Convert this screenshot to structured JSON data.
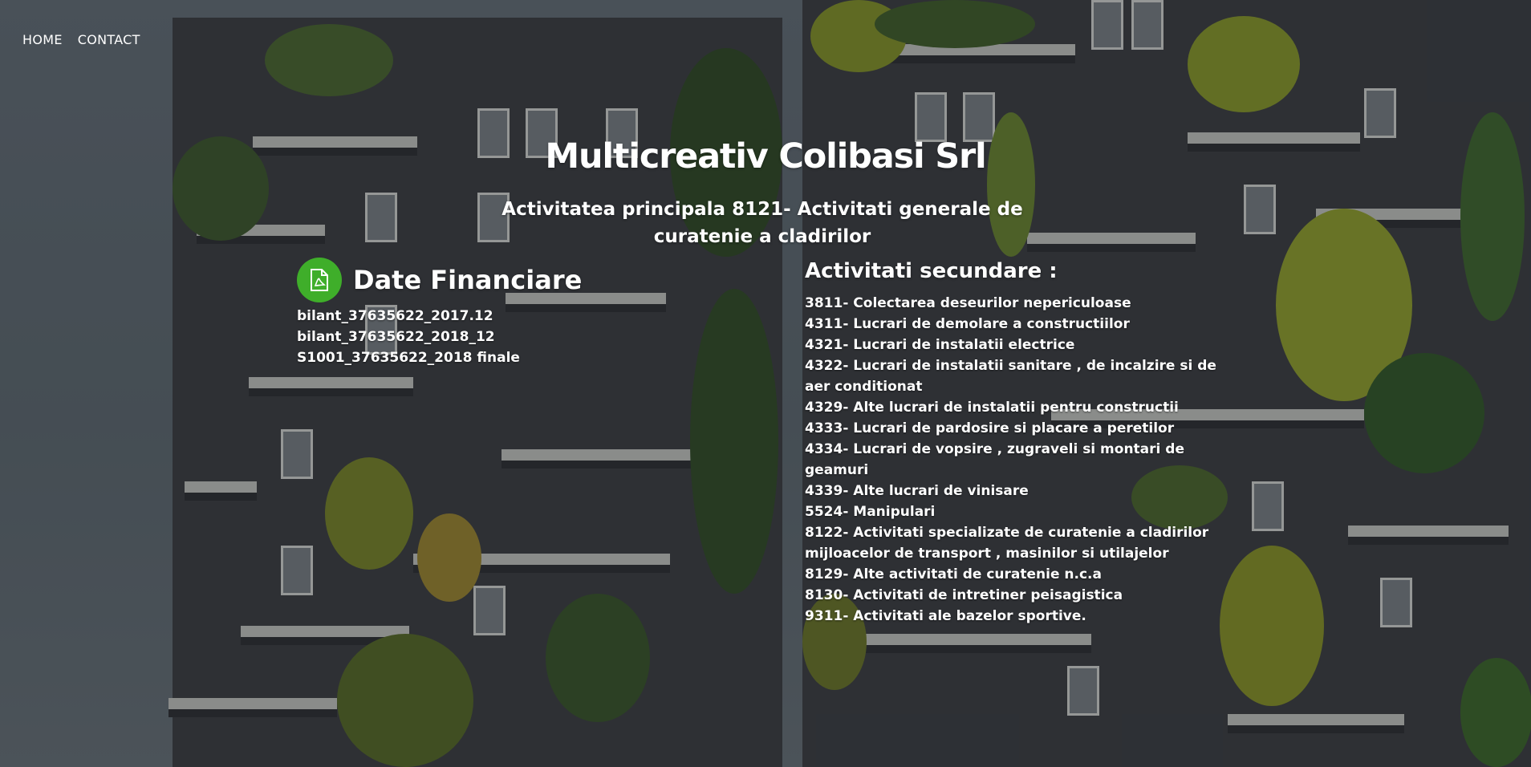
{
  "nav": {
    "items": [
      "HOME",
      "CONTACT"
    ]
  },
  "header": {
    "title": "Multicreativ Colibasi Srl",
    "subtitle": "Activitatea principala 8121- Activitati generale de curatenie a cladirilor"
  },
  "financial": {
    "title": "Date Financiare",
    "icon": "pdf-icon",
    "icon_color": "#3fae2a",
    "links": [
      "bilant_37635622_2017.12",
      "bilant_37635622_2018_12",
      "S1001_37635622_2018 finale"
    ]
  },
  "secondary": {
    "title": "Activitati secundare :",
    "items": [
      "3811- Colectarea deseurilor nepericuloase",
      "4311- Lucrari de demolare a constructiilor",
      "4321- Lucrari de instalatii electrice",
      "4322- Lucrari de instalatii sanitare , de incalzire si de aer conditionat",
      "4329- Alte lucrari de instalatii pentru constructii",
      "4333- Lucrari de pardosire si placare a peretilor",
      "4334- Lucrari de vopsire , zugraveli si montari de geamuri",
      "4339- Alte lucrari de vinisare",
      "5524- Manipulari",
      "8122- Activitati specializate de curatenie a cladirilor mijloacelor de transport , masinilor si utilajelor",
      "8129- Alte activitati de curatenie n.c.a",
      "8130- Activitati de intretiner peisagistica",
      "9311- Activitati ale bazelor sportive."
    ]
  }
}
